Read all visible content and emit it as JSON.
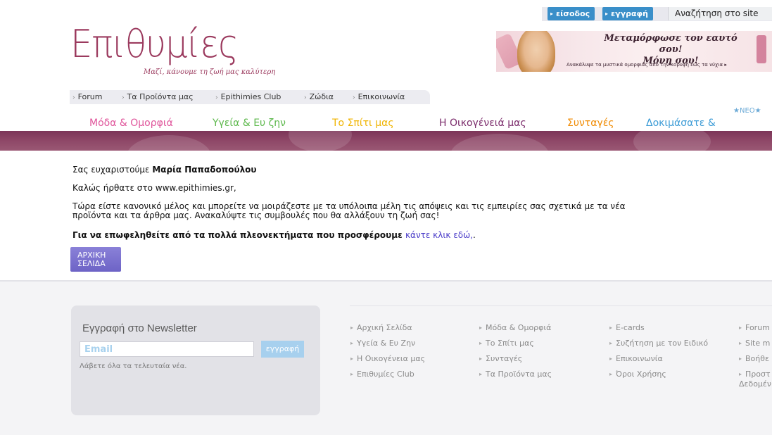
{
  "topbar": {
    "login_label": "είσοδος",
    "register_label": "εγγραφή",
    "search_label": "Αναζήτηση στο site"
  },
  "logo": {
    "text": "Επιθυμίες",
    "tagline": "Μαζί, κάνουμε τη ζωή μας καλύτερη"
  },
  "banner": {
    "headline_line1": "Μεταμόρφωσε τον εαυτό σου!",
    "headline_line2": "Μόνη σου!",
    "sub": "Ανακάλυψε τα μυστικά ομορφιάς απο την κορυφή εώς τα νύχια ▸"
  },
  "subnav": {
    "items": [
      {
        "label": "Forum"
      },
      {
        "label": "Τα Προϊόντα μας"
      },
      {
        "label": "Epithimies Club"
      },
      {
        "label": "Ζώδια"
      },
      {
        "label": "Επικοινωνία"
      }
    ]
  },
  "categories": {
    "neo_badge": "★ΝΕΟ★",
    "items": [
      {
        "label": "Μόδα & Ομορφιά",
        "color": "#e0559b"
      },
      {
        "label": "Υγεία & Ευ ζην",
        "color": "#5db84c"
      },
      {
        "label": "Το Σπίτι μας",
        "color": "#f0b400"
      },
      {
        "label": "Η Οικογένειά μας",
        "color": "#7a2a6a"
      },
      {
        "label": "Συνταγές",
        "color": "#f08a00"
      },
      {
        "label": "Δοκιμάσατε & Προτείνετε",
        "color": "#3b9bd6"
      }
    ]
  },
  "content": {
    "thanks_prefix": "Σας ευχαριστούμε ",
    "user_name": "Μαρία  Παπαδοπούλου",
    "welcome": "Καλώς ήρθατε στο www.epithimies.gr,",
    "body": "Τώρα είστε κανονικό μέλος και μπορείτε να μοιράζεστε με τα υπόλοιπα μέλη τις απόψεις και τις εμπειρίες σας σχετικά με τα νέα προϊόντα και τα άρθρα μας. Ανακαλύψτε τις συμβουλές που θα αλλάξουν τη ζωή σας!",
    "benefit_text": "Για να επωφεληθείτε από τα πολλά πλεονεκτήματα που προσφέρουμε ",
    "benefit_link": "κάντε κλικ εδώ,",
    "benefit_end": ".",
    "home_button_line1": "ΑΡΧΙΚΗ",
    "home_button_line2": "ΣΕΛΙΔΑ"
  },
  "newsletter": {
    "title": "Εγγραφή στο Newsletter",
    "email_placeholder": "Email",
    "submit_label": "εγγραφή",
    "note": "Λάβετε όλα τα τελευταία νέα."
  },
  "footer_links": {
    "col1": [
      "Αρχική Σελίδα",
      "Υγεία & Ευ Ζην",
      "Η Οικογένεια μας",
      "Επιθυμίες Club"
    ],
    "col2": [
      "Μόδα & Ομορφιά",
      "Το Σπίτι μας",
      "Συνταγές",
      "Τα Προϊόντα μας"
    ],
    "col3": [
      "E-cards",
      "Συζήτηση με τον Ειδικό",
      "Επικοινωνία",
      "Όροι Χρήσης"
    ],
    "col4": [
      "Forum",
      "Site m",
      "Βοήθε",
      "Προστ",
      "Δεδομέν"
    ]
  }
}
